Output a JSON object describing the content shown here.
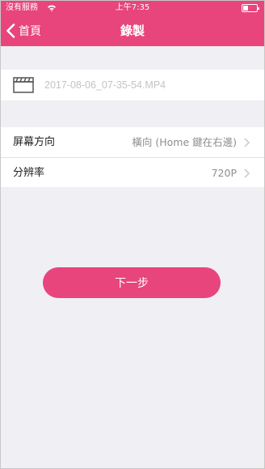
{
  "status_bar": {
    "carrier": "沒有服務",
    "time": "上午7:35",
    "battery_level": 0.35
  },
  "nav": {
    "back_label": "首頁",
    "title": "錄製"
  },
  "file": {
    "name": "2017-08-06_07-35-54.MP4"
  },
  "settings": {
    "items": [
      {
        "label": "屏幕方向",
        "value": "橫向 (Home 鍵在右邊)"
      },
      {
        "label": "分辨率",
        "value": "720P"
      }
    ]
  },
  "next_button": {
    "label": "下一步"
  },
  "colors": {
    "accent": "#e8457c",
    "background": "#efeff4"
  }
}
